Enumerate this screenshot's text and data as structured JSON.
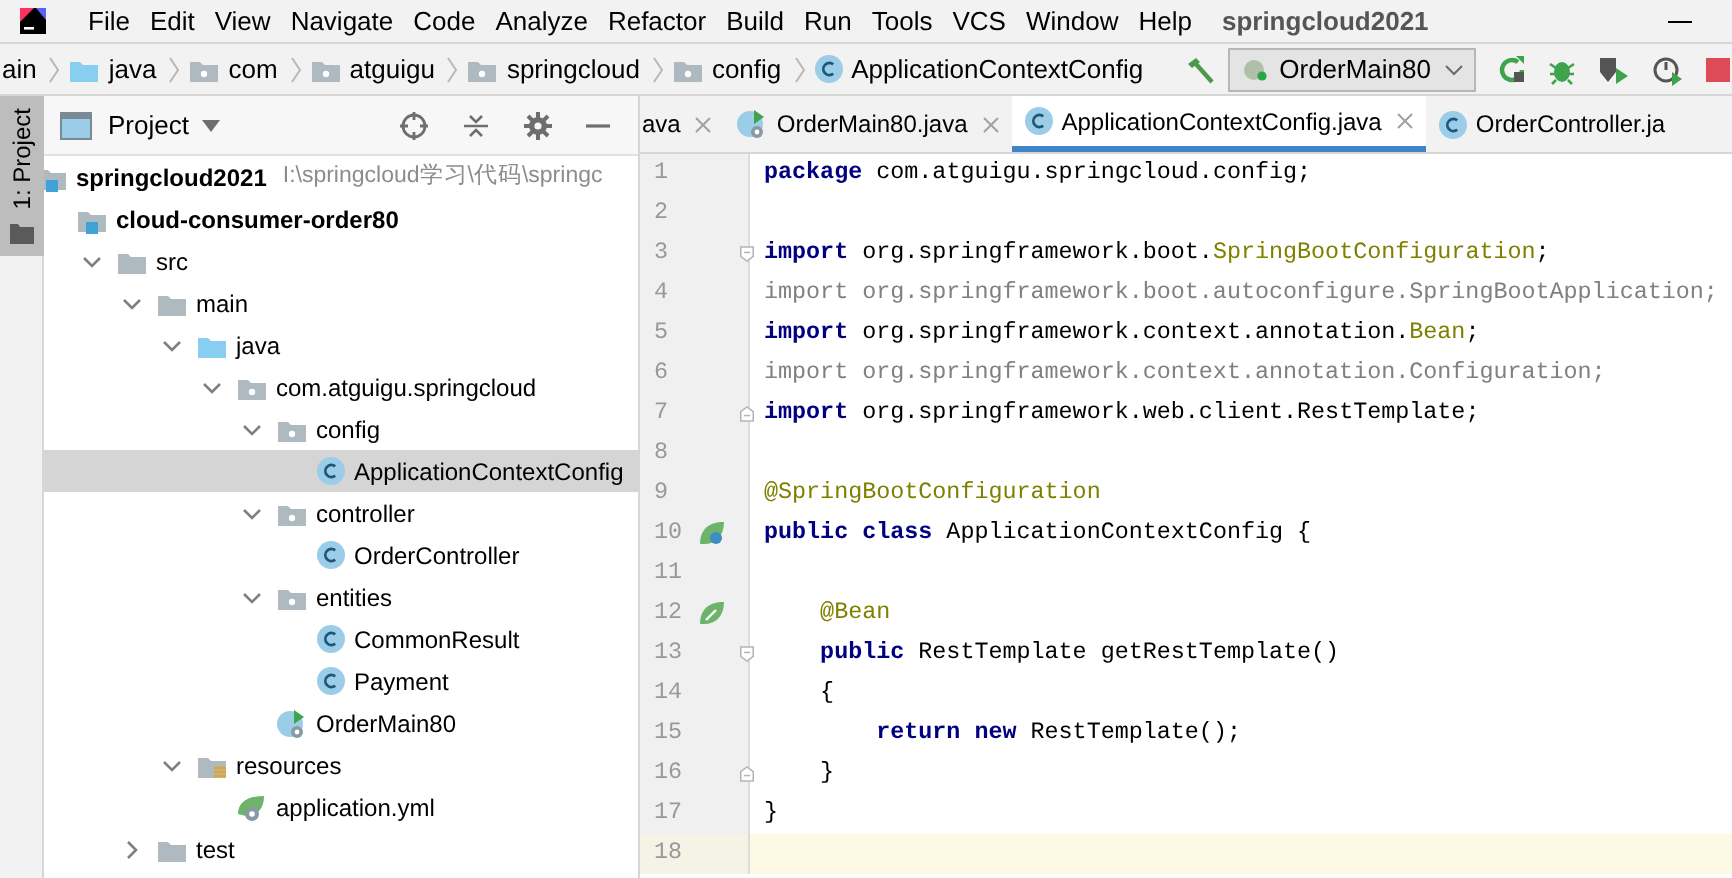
{
  "menu": {
    "items": [
      {
        "label": "File"
      },
      {
        "label": "Edit"
      },
      {
        "label": "View"
      },
      {
        "label": "Navigate"
      },
      {
        "label": "Code"
      },
      {
        "label": "Analyze"
      },
      {
        "label": "Refactor"
      },
      {
        "label": "Build"
      },
      {
        "label": "Run"
      },
      {
        "label": "Tools"
      },
      {
        "label": "VCS"
      },
      {
        "label": "Window"
      },
      {
        "label": "Help"
      }
    ],
    "project_title": "springcloud2021"
  },
  "breadcrumb": [
    {
      "label": "ain",
      "kind": "text"
    },
    {
      "label": "java",
      "kind": "source-root"
    },
    {
      "label": "com",
      "kind": "package"
    },
    {
      "label": "atguigu",
      "kind": "package"
    },
    {
      "label": "springcloud",
      "kind": "package"
    },
    {
      "label": "config",
      "kind": "package"
    },
    {
      "label": "ApplicationContextConfig",
      "kind": "class"
    }
  ],
  "run_config": {
    "value": "OrderMain80"
  },
  "side_tab": {
    "label": "1: Project",
    "selected": true
  },
  "project_panel": {
    "title": "Project",
    "tree": [
      {
        "label": "springcloud2021",
        "kind": "module",
        "selected": false,
        "path": "I:\\springcloud学习\\代码\\springc",
        "children": [
          {
            "label": "cloud-consumer-order80",
            "kind": "module",
            "selected": false,
            "children": [
              {
                "label": "src",
                "kind": "folder",
                "selected": false,
                "expanded": true,
                "children": [
                  {
                    "label": "main",
                    "kind": "folder",
                    "selected": false,
                    "expanded": true,
                    "children": [
                      {
                        "label": "java",
                        "kind": "source-root",
                        "selected": false,
                        "expanded": true,
                        "children": [
                          {
                            "label": "com.atguigu.springcloud",
                            "kind": "package",
                            "selected": false,
                            "expanded": true,
                            "children": [
                              {
                                "label": "config",
                                "kind": "package",
                                "selected": false,
                                "expanded": true,
                                "children": [
                                  {
                                    "label": "ApplicationContextConfig",
                                    "kind": "class",
                                    "selected": true
                                  }
                                ]
                              },
                              {
                                "label": "controller",
                                "kind": "package",
                                "selected": false,
                                "expanded": true,
                                "children": [
                                  {
                                    "label": "OrderController",
                                    "kind": "class",
                                    "selected": false
                                  }
                                ]
                              },
                              {
                                "label": "entities",
                                "kind": "package",
                                "selected": false,
                                "expanded": true,
                                "children": [
                                  {
                                    "label": "CommonResult",
                                    "kind": "class",
                                    "selected": false
                                  },
                                  {
                                    "label": "Payment",
                                    "kind": "class",
                                    "selected": false
                                  }
                                ]
                              },
                              {
                                "label": "OrderMain80",
                                "kind": "main-class",
                                "selected": false
                              }
                            ]
                          }
                        ]
                      },
                      {
                        "label": "resources",
                        "kind": "resources-root",
                        "selected": false,
                        "expanded": true,
                        "children": [
                          {
                            "label": "application.yml",
                            "kind": "yaml",
                            "selected": false
                          }
                        ]
                      }
                    ]
                  },
                  {
                    "label": "test",
                    "kind": "folder",
                    "selected": false,
                    "expanded": false
                  }
                ]
              }
            ]
          }
        ]
      }
    ]
  },
  "editor": {
    "tabs": [
      {
        "label": "ava",
        "kind": "none",
        "selected": false,
        "closable": true
      },
      {
        "label": "OrderMain80.java",
        "kind": "main-class",
        "selected": false,
        "closable": true
      },
      {
        "label": "ApplicationContextConfig.java",
        "kind": "class",
        "selected": true,
        "closable": true
      },
      {
        "label": "OrderController.ja",
        "kind": "class",
        "selected": false,
        "closable": false
      }
    ],
    "lines": [
      {
        "number": "1",
        "current": false,
        "tokens": [
          {
            "text": "package",
            "kind": "keyword"
          },
          {
            "text": " com.atguigu.springcloud.config;",
            "kind": "plain"
          }
        ]
      },
      {
        "number": "2",
        "current": false
      },
      {
        "number": "3",
        "current": false,
        "fold": {
          "kind": "start"
        },
        "tokens": [
          {
            "text": "import",
            "kind": "keyword"
          },
          {
            "text": " org.springframework.boot.",
            "kind": "plain"
          },
          {
            "text": "SpringBootConfiguration",
            "kind": "annotation"
          },
          {
            "text": ";",
            "kind": "plain"
          }
        ]
      },
      {
        "number": "4",
        "current": false,
        "tokens": [
          {
            "text": "import org.springframework.boot.autoconfigure.SpringBootApplication;",
            "kind": "unused"
          }
        ]
      },
      {
        "number": "5",
        "current": false,
        "tokens": [
          {
            "text": "import",
            "kind": "keyword"
          },
          {
            "text": " org.springframework.context.annotation.",
            "kind": "plain"
          },
          {
            "text": "Bean",
            "kind": "annotation"
          },
          {
            "text": ";",
            "kind": "plain"
          }
        ]
      },
      {
        "number": "6",
        "current": false,
        "tokens": [
          {
            "text": "import org.springframework.context.annotation.Configuration;",
            "kind": "unused"
          }
        ]
      },
      {
        "number": "7",
        "current": false,
        "fold": {
          "kind": "end"
        },
        "tokens": [
          {
            "text": "import",
            "kind": "keyword"
          },
          {
            "text": " org.springframework.web.client.RestTemplate;",
            "kind": "plain"
          }
        ]
      },
      {
        "number": "8",
        "current": false
      },
      {
        "number": "9",
        "current": false,
        "tokens": [
          {
            "text": "@SpringBootConfiguration",
            "kind": "annotation"
          }
        ]
      },
      {
        "number": "10",
        "current": false,
        "gutter": {
          "kind": "bean-class"
        },
        "tokens": [
          {
            "text": "public class",
            "kind": "keyword"
          },
          {
            "text": " ApplicationContextConfig {",
            "kind": "plain"
          }
        ]
      },
      {
        "number": "11",
        "current": false
      },
      {
        "number": "12",
        "current": false,
        "gutter": {
          "kind": "bean-method"
        },
        "tokens": [
          {
            "text": "    @Bean",
            "kind": "annotation"
          }
        ]
      },
      {
        "number": "13",
        "current": false,
        "fold": {
          "kind": "start"
        },
        "tokens": [
          {
            "text": "    public",
            "kind": "keyword"
          },
          {
            "text": " RestTemplate getRestTemplate()",
            "kind": "plain"
          }
        ]
      },
      {
        "number": "14",
        "current": false,
        "tokens": [
          {
            "text": "    {",
            "kind": "plain"
          }
        ]
      },
      {
        "number": "15",
        "current": false,
        "tokens": [
          {
            "text": "        return new",
            "kind": "keyword"
          },
          {
            "text": " RestTemplate();",
            "kind": "plain"
          }
        ]
      },
      {
        "number": "16",
        "current": false,
        "fold": {
          "kind": "end"
        },
        "tokens": [
          {
            "text": "    }",
            "kind": "plain"
          }
        ]
      },
      {
        "number": "17",
        "current": false,
        "tokens": [
          {
            "text": "}",
            "kind": "plain"
          }
        ]
      },
      {
        "number": "18",
        "current": true
      }
    ]
  }
}
